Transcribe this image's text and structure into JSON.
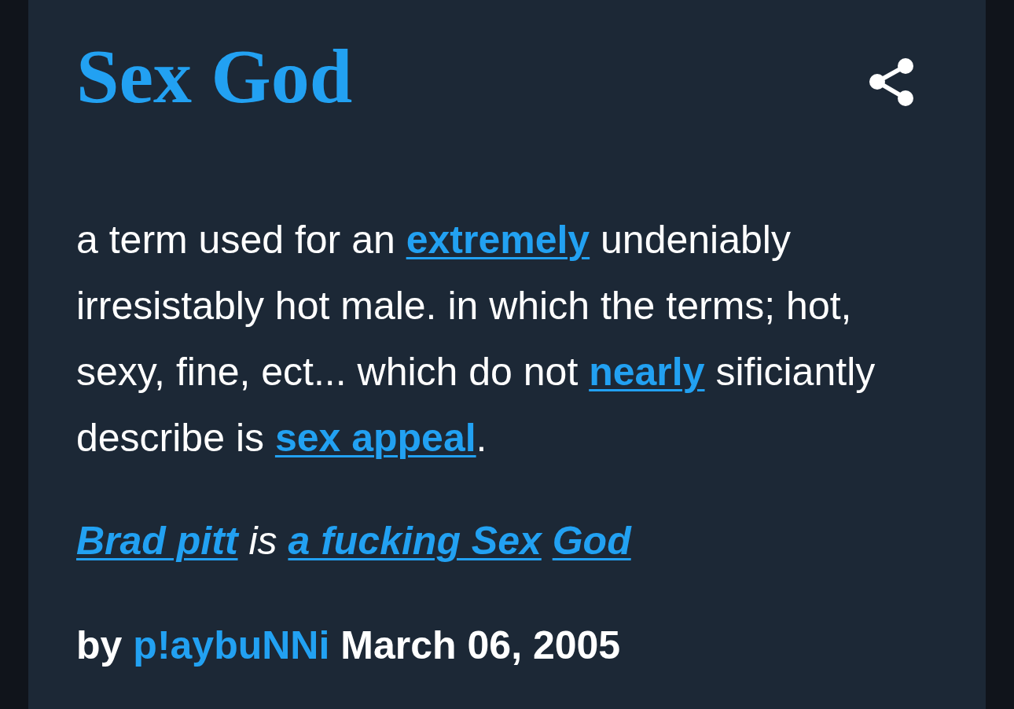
{
  "definition": {
    "title": "Sex God",
    "meaning": [
      {
        "kind": "text",
        "text": "a term used for an "
      },
      {
        "kind": "link",
        "text": "extremely"
      },
      {
        "kind": "text",
        "text": " undeniably irresistably hot male. in which the terms; hot, sexy, fine, ect... which do not "
      },
      {
        "kind": "link",
        "text": "nearly"
      },
      {
        "kind": "text",
        "text": " sificiantly describe is "
      },
      {
        "kind": "link",
        "text": "sex appeal"
      },
      {
        "kind": "text",
        "text": "."
      }
    ],
    "example": [
      {
        "kind": "link",
        "text": "Brad pitt"
      },
      {
        "kind": "text",
        "text": " is "
      },
      {
        "kind": "link",
        "text": "a fucking Sex"
      },
      {
        "kind": "link",
        "text": "God"
      }
    ],
    "author": {
      "prefix": "by",
      "name": "p!aybuNNi",
      "date": "March 06, 2005"
    }
  }
}
